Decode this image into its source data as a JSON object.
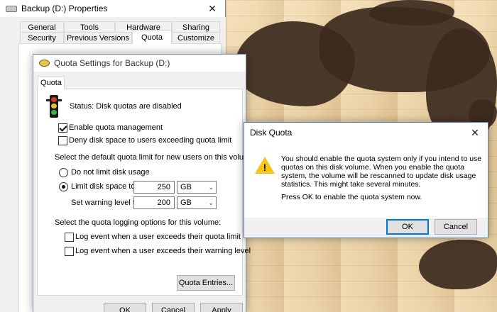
{
  "properties_window": {
    "title": "Backup (D:) Properties",
    "tabs_row1": [
      "General",
      "Tools",
      "Hardware",
      "Sharing"
    ],
    "tabs_row2": [
      "Security",
      "Previous Versions",
      "Quota",
      "Customize"
    ],
    "active_tab": "Quota"
  },
  "quota_settings": {
    "title": "Quota Settings for Backup (D:)",
    "tab": "Quota",
    "status_text": "Status:  Disk quotas are disabled",
    "enable_quota_label": "Enable quota management",
    "enable_quota_checked": true,
    "deny_disk_label": "Deny disk space to users exceeding quota limit",
    "deny_disk_checked": false,
    "default_limit_heading": "Select the default quota limit for new users on this volume:",
    "no_limit_label": "Do not limit disk usage",
    "limit_label": "Limit disk space to",
    "limit_value": "250",
    "limit_unit": "GB",
    "warning_label": "Set warning level to",
    "warning_value": "200",
    "warning_unit": "GB",
    "logging_heading": "Select the quota logging options for this volume:",
    "log_limit_label": "Log event when a user exceeds their quota limit",
    "log_warning_label": "Log event when a user exceeds their warning level",
    "quota_entries_button": "Quota Entries...",
    "ok_button": "OK",
    "cancel_button": "Cancel",
    "apply_button": "Apply"
  },
  "disk_quota_dialog": {
    "title": "Disk Quota",
    "message_line1": "You should enable the quota system only if you intend to use",
    "message_line2": "quotas on this disk volume.  When you enable the quota",
    "message_line3": "system, the volume will be rescanned to update disk usage",
    "message_line4": "statistics. This might take several minutes.",
    "message_line5": "Press OK to enable the quota system now.",
    "ok_button": "OK",
    "cancel_button": "Cancel"
  },
  "icons": {
    "close": "✕",
    "warning": "!",
    "chevron": "⌄"
  }
}
